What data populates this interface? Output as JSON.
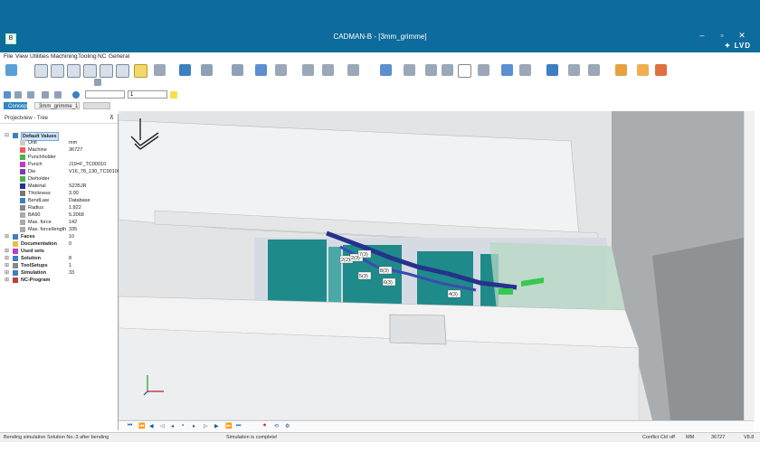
{
  "window": {
    "title": "CADMAN-B - [3mm_grimme]",
    "brand": "LVD"
  },
  "menu": [
    "File",
    "View",
    "Utilities",
    "Machining",
    "Tooling",
    "NC",
    "General"
  ],
  "toolbar": {
    "combo_value": "1"
  },
  "tabs": [
    "Concept",
    "3mm_grimme_1"
  ],
  "panel": {
    "title": "Projectview - Tree",
    "tree": [
      {
        "label": "Default Values",
        "bold": true,
        "value": ""
      },
      {
        "label": "Unit",
        "value": "mm"
      },
      {
        "label": "Machine",
        "value": "36727"
      },
      {
        "label": "Punchholder",
        "value": ""
      },
      {
        "label": "Punch",
        "value": "J19=F_TC00010"
      },
      {
        "label": "Die",
        "value": "V16_78_130_TC00100"
      },
      {
        "label": "Dieholder",
        "value": ""
      },
      {
        "label": "Material",
        "value": "S235JR"
      },
      {
        "label": "Thickness",
        "value": "3.00"
      },
      {
        "label": "BendLaw",
        "value": "Database"
      },
      {
        "label": "Radius",
        "value": "1.822"
      },
      {
        "label": "BA90",
        "value": "5.2068"
      },
      {
        "label": "Max. force",
        "value": "142"
      },
      {
        "label": "Max. force/length",
        "value": "335"
      },
      {
        "label": "Faces",
        "bold": true,
        "value": "10"
      },
      {
        "label": "Documentation",
        "bold": true,
        "value": "0"
      },
      {
        "label": "Used sets",
        "bold": true,
        "value": ""
      },
      {
        "label": "Solution",
        "bold": true,
        "value": "8"
      },
      {
        "label": "ToolSetups",
        "bold": true,
        "value": "1"
      },
      {
        "label": "Simulation",
        "bold": true,
        "value": "33"
      },
      {
        "label": "NC-Program",
        "bold": true,
        "value": ""
      }
    ]
  },
  "viewport": {
    "bend_labels": [
      "2(2)",
      "2(3)",
      "7(3)",
      "8(3)",
      "5(3)",
      "6(3)",
      "4(3)"
    ]
  },
  "status": {
    "left": "Bending simulation Solution No.:3 after bending",
    "center": "Simulation is complete!",
    "conflict": "Conflict Ctrl off",
    "unit": "MM",
    "machine": "36727",
    "version": "V8.8"
  },
  "colors": {
    "titlebar": "#0e6b9d",
    "tool_teal": "#1f8a8a",
    "part_blue": "#25338c",
    "accent_green": "#37c84f"
  }
}
